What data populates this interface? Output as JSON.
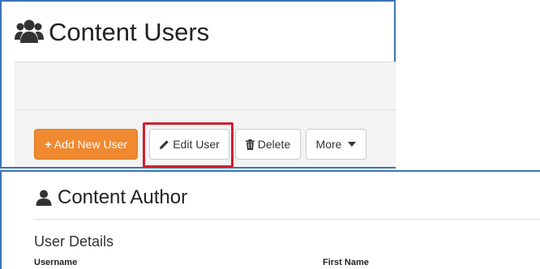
{
  "users_panel": {
    "title": "Content Users",
    "icon": "users-icon",
    "toolbar": {
      "add_label": "Add New User",
      "add_icon": "+",
      "edit_label": "Edit User",
      "edit_icon": "pencil-icon",
      "delete_label": "Delete",
      "delete_icon": "trash-icon",
      "more_label": "More"
    },
    "highlighted_button": "Edit User"
  },
  "author_panel": {
    "title": "Content Author",
    "icon": "user-icon",
    "section_title": "User Details",
    "fields": {
      "username_label": "Username",
      "first_name_label": "First Name"
    }
  },
  "colors": {
    "accent_orange": "#f0892f",
    "highlight_red": "#d0202f",
    "frame_blue": "#3b73b9"
  }
}
